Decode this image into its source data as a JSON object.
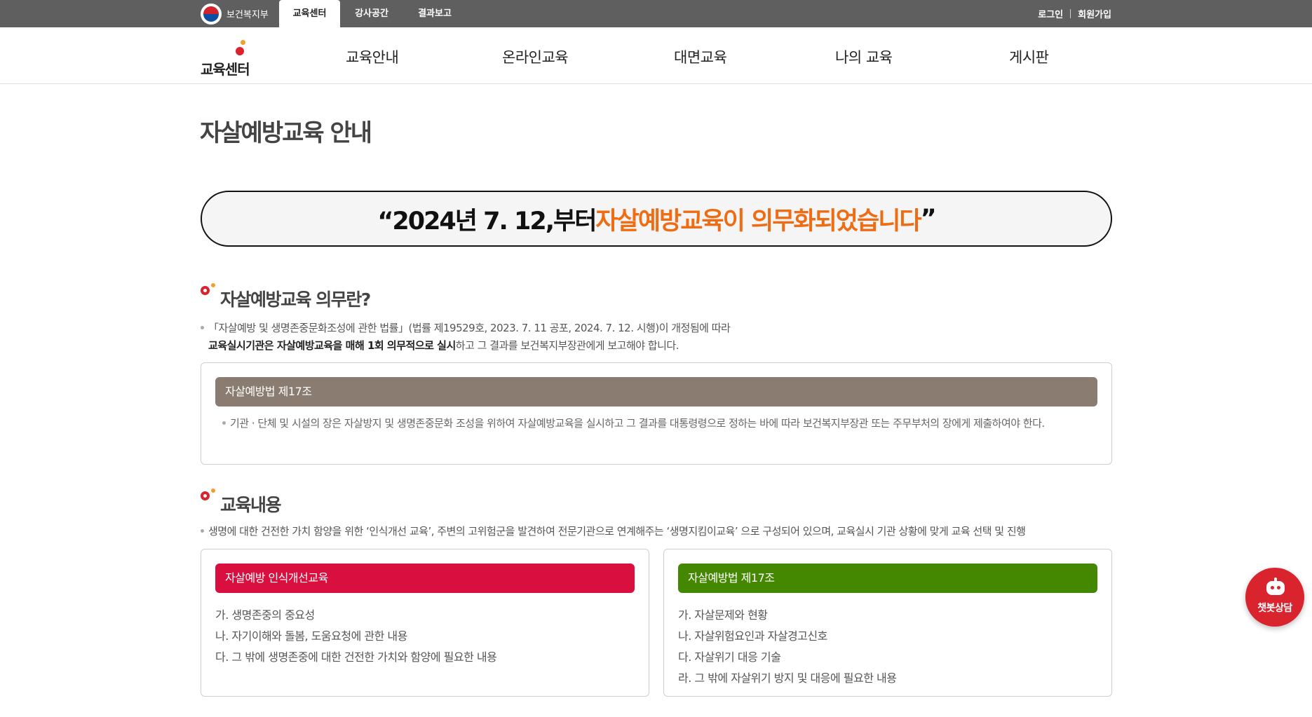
{
  "topbar": {
    "ministry": "보건복지부",
    "tabs": [
      "교육센터",
      "강사공간",
      "결과보고"
    ],
    "active_tab": "교육센터",
    "login": "로그인",
    "signup": "회원가입"
  },
  "logo": {
    "text": "교육센터"
  },
  "nav": [
    "교육안내",
    "온라인교육",
    "대면교육",
    "나의 교육",
    "게시판"
  ],
  "page_title": "자살예방교육 안내",
  "banner": {
    "prefix": "“2024년 7. 12,부터 ",
    "accent": "자살예방교육이 의무화되었습니다",
    "suffix": "”"
  },
  "section1": {
    "title": "자살예방교육 의무란?",
    "line1": "「자살예방 및 생명존중문화조성에 관한 법률」(법률 제19529호, 2023. 7. 11 공포, 2024. 7. 12. 시행)이 개정됨에 따라",
    "line2_bold": "교육실시기관은 자살예방교육을 매해 1회 의무적으로 실시",
    "line2_rest": "하고 그 결과를 보건복지부장관에게 보고해야 합니다.",
    "box_title": "자살예방법 제17조",
    "box_text": "기관 · 단체 및 시설의 장은 자살방지 및 생명존중문화 조성을 위하여 자살예방교육을 실시하고 그 결과를 대통령령으로 정하는 바에 따라 보건복지부장관 또는 주무부처의 장에게 제출하여야 한다."
  },
  "section2": {
    "title": "교육내용",
    "desc": "생명에 대한 건전한 가치 함양을 위한 ‘인식개선 교육’, 주변의 고위험군을 발견하여 전문기관으로 연계해주는 ‘생명지킴이교육’ 으로 구성되어 있으며, 교육실시 기관 상황에 맞게 교육 선택 및 진행",
    "left_box": {
      "title": "자살예방 인식개선교육",
      "items": [
        "가. 생명존중의 중요성",
        "나. 자기이해와 돌봄, 도움요청에 관한 내용",
        "다. 그 밖에 생명존중에 대한 건전한 가치와 함양에 필요한 내용"
      ]
    },
    "right_box": {
      "title": "자살예방법 제17조",
      "items": [
        "가. 자살문제와 현황",
        "나. 자살위험요인과 자살경고신호",
        "다. 자살위기 대응 기술",
        "라. 그 밖에 자살위기 방지 및 대응에 필요한 내용"
      ]
    }
  },
  "chatbot": {
    "label": "챗봇상담"
  },
  "colors": {
    "topbar": "#5f5f5f",
    "accent_orange": "#ee6d14",
    "box_brown": "#8a7c70",
    "box_red": "#d90f3f",
    "box_green": "#448802",
    "chatbot_red": "#d9232d"
  }
}
